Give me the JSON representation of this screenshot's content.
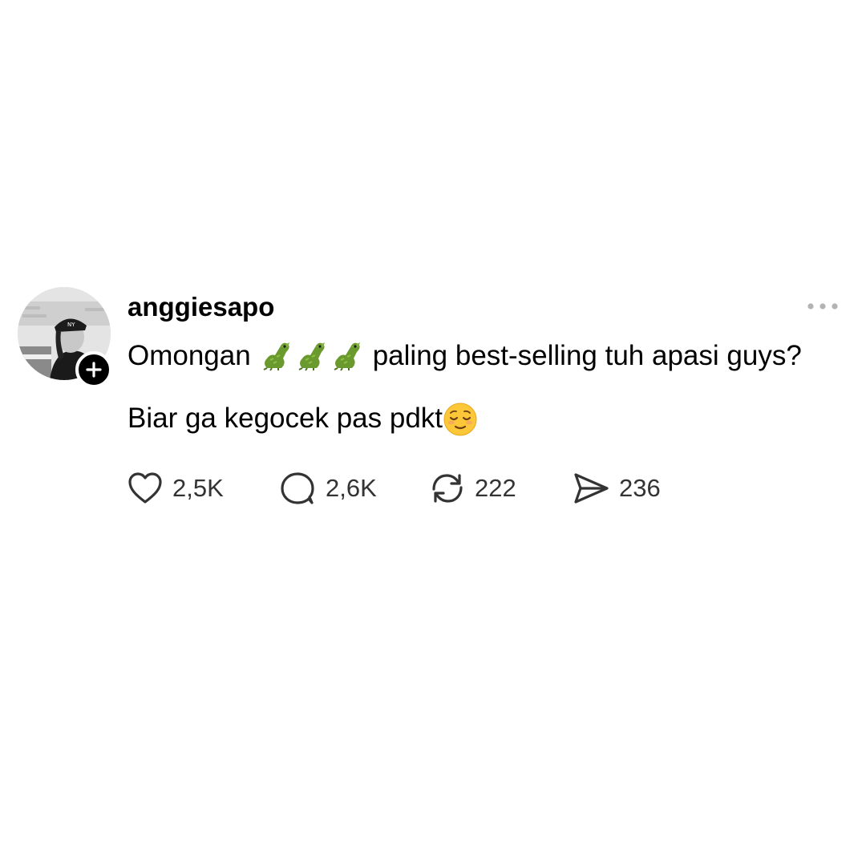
{
  "post": {
    "username": "anggiesapo",
    "text_line1_before": "Omongan",
    "text_line1_after": "paling best-selling tuh apasi guys?",
    "text_line2": "Biar ga kegocek pas pdkt",
    "emojis_line1": [
      "crocodile",
      "crocodile",
      "crocodile"
    ],
    "emoji_line2": "relieved-face"
  },
  "actions": {
    "likes": "2,5K",
    "replies": "2,6K",
    "reposts": "222",
    "shares": "236"
  },
  "icons": {
    "avatar": "avatar-photo",
    "follow": "plus-icon",
    "more": "more-dots-icon",
    "like": "heart-icon",
    "reply": "comment-bubble-icon",
    "repost": "repost-icon",
    "share": "send-icon"
  },
  "colors": {
    "background": "#ffffff",
    "text": "#000000",
    "secondary_text": "#333333",
    "more_dots": "#b3b3b3",
    "badge": "#000000"
  }
}
